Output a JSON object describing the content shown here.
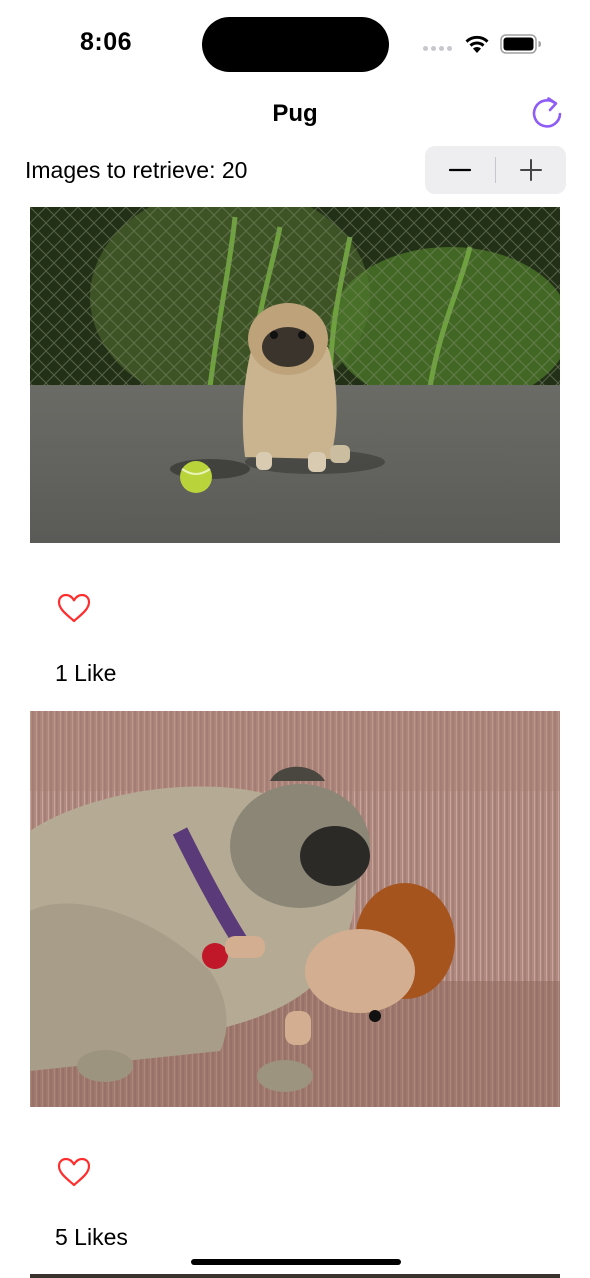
{
  "status_bar": {
    "time": "8:06",
    "icons": [
      "cellular-signal-icon",
      "wifi-icon",
      "battery-icon"
    ]
  },
  "nav": {
    "title": "Pug",
    "refresh_icon": "refresh-icon",
    "accent_color": "#8e5cf7"
  },
  "controls": {
    "images_label": "Images to retrieve: 20",
    "decrement_symbol": "−",
    "increment_symbol": "+"
  },
  "feed": {
    "posts": [
      {
        "image": "pug sitting on pavement near a tennis ball",
        "heart_icon": "heart-outline-icon",
        "likes_text": "1 Like"
      },
      {
        "image": "pug sleeping on couch with plush hedgehog toy",
        "heart_icon": "heart-outline-icon",
        "likes_text": "5 Likes"
      }
    ],
    "heart_color": "#ff2d2d"
  }
}
